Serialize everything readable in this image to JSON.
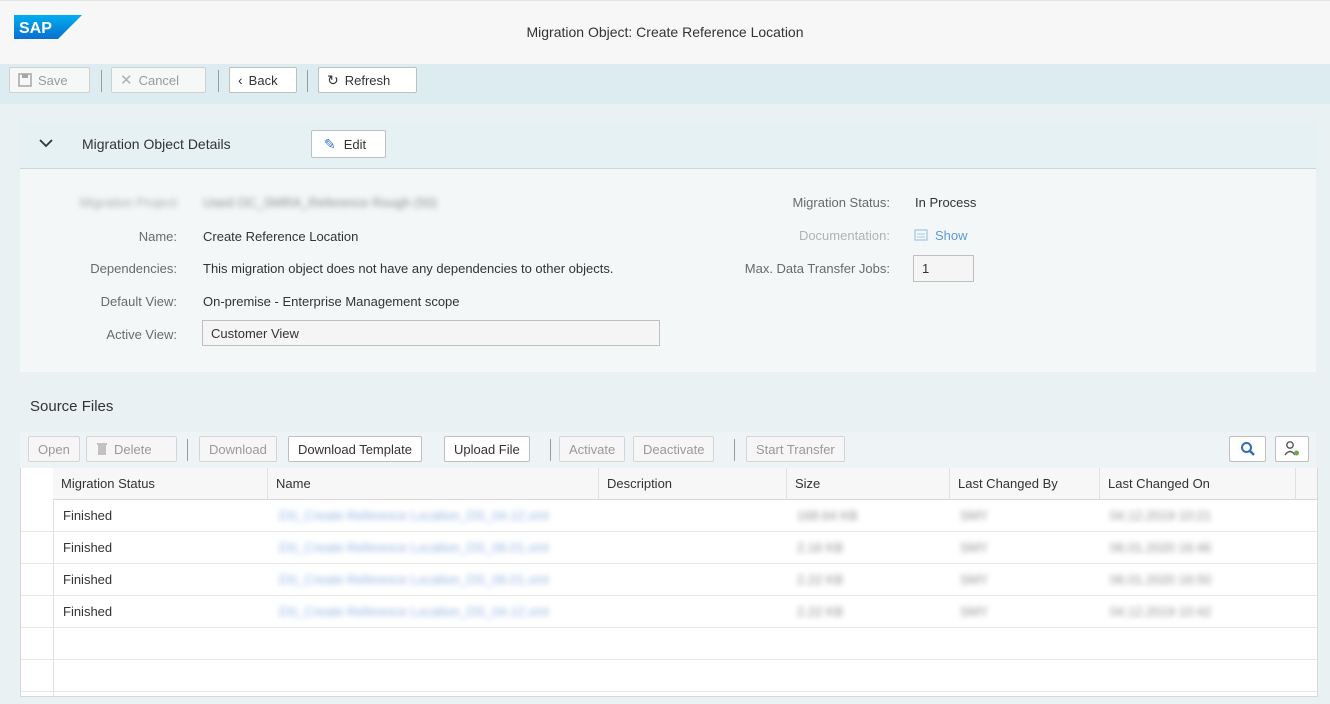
{
  "app": {
    "logo_text": "SAP",
    "brand_color": "#0a6ed1",
    "title": "Migration Object: Create Reference Location"
  },
  "toolbar": {
    "save": "Save",
    "cancel": "Cancel",
    "back": "Back",
    "refresh": "Refresh"
  },
  "details": {
    "section_title": "Migration Object Details",
    "edit": "Edit",
    "project_label": "Migration Project",
    "project_value": "Used OC_SMRA_Reference Rough (50)",
    "name_label": "Name:",
    "name_value": "Create Reference Location",
    "dependencies_label": "Dependencies:",
    "dependencies_value": "This migration object does not have any dependencies to other objects.",
    "default_view_label": "Default View:",
    "default_view_value": "On-premise - Enterprise Management scope",
    "active_view_label": "Active View:",
    "active_view_value": "Customer View",
    "migration_status_label": "Migration Status:",
    "migration_status_value": "In Process",
    "documentation_label": "Documentation:",
    "documentation_value": "Show",
    "max_jobs_label": "Max. Data Transfer Jobs:",
    "max_jobs_value": "1"
  },
  "source_files": {
    "title": "Source Files",
    "buttons": {
      "open": "Open",
      "delete": "Delete",
      "download": "Download",
      "download_template": "Download Template",
      "upload_file": "Upload File",
      "activate": "Activate",
      "deactivate": "Deactivate",
      "start_transfer": "Start Transfer"
    },
    "columns": [
      "Migration Status",
      "Name",
      "Description",
      "Size",
      "Last Changed By",
      "Last Changed On"
    ],
    "rows": [
      {
        "status": "Finished",
        "name": "DS_Create Reference Location_DS_04.12.xml",
        "description": "",
        "size": "168.64 KB",
        "changed_by": "SMY",
        "changed_on": "04.12.2019 10:21"
      },
      {
        "status": "Finished",
        "name": "DS_Create Reference Location_DS_06.01.xml",
        "description": "",
        "size": "2.16 KB",
        "changed_by": "SMY",
        "changed_on": "06.01.2020 16:46"
      },
      {
        "status": "Finished",
        "name": "DS_Create Reference Location_DS_06.01.xml",
        "description": "",
        "size": "2.22 KB",
        "changed_by": "SMY",
        "changed_on": "06.01.2020 16:50"
      },
      {
        "status": "Finished",
        "name": "DS_Create Reference Location_DS_04.12.xml",
        "description": "",
        "size": "2.22 KB",
        "changed_by": "SMY",
        "changed_on": "04.12.2019 10:42"
      }
    ]
  }
}
